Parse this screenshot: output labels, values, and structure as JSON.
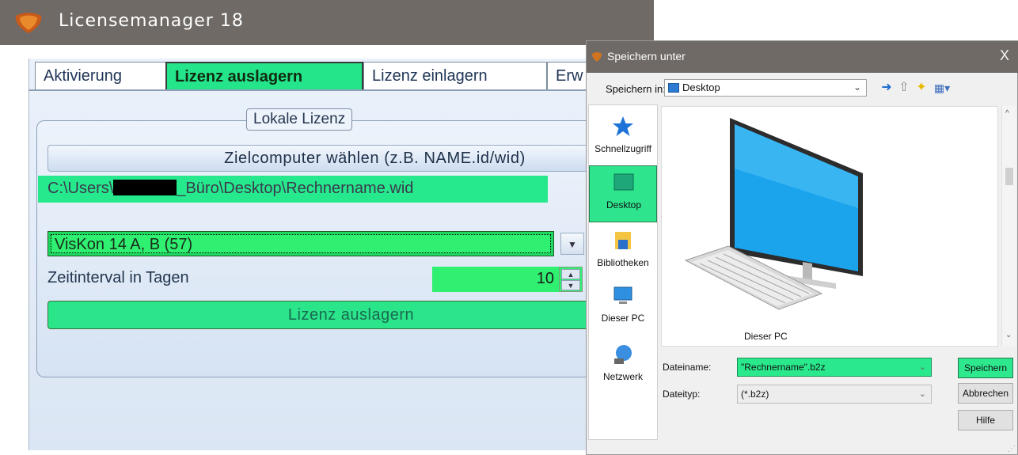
{
  "app": {
    "title": "Licensemanager 18",
    "tabs": [
      "Aktivierung",
      "Lizenz auslagern",
      "Lizenz einlagern",
      "Erw"
    ],
    "group_title": "Lokale Lizenz",
    "target_button": "Zielcomputer wählen (z.B. NAME.id/wid)",
    "path": {
      "prefix": "C:\\Users\\",
      "suffix": "_Büro\\Desktop\\Rechnername.wid"
    },
    "license_select": "VisKon 14 A, B (57)",
    "interval_label": "Zeitinterval in Tagen",
    "interval_value": "10",
    "export_button": "Lizenz auslagern"
  },
  "dialog": {
    "title": "Speichern unter",
    "close": "X",
    "save_in_label": "Speichern in:",
    "save_in_value": "Desktop",
    "places": [
      "Schnellzugriff",
      "Desktop",
      "Bibliotheken",
      "Dieser PC",
      "Netzwerk"
    ],
    "selected_place": "Desktop",
    "file_item": "Dieser PC",
    "filename_label": "Dateiname:",
    "filename_value": "\"Rechnername\".b2z",
    "filetype_label": "Dateityp:",
    "filetype_value": "(*.b2z)",
    "buttons": {
      "save": "Speichern",
      "cancel": "Abbrechen",
      "help": "Hilfe"
    }
  },
  "icons": [
    "app-logo-icon",
    "back-icon",
    "up-folder-icon",
    "new-folder-icon",
    "view-menu-icon",
    "star-icon",
    "desktop-icon",
    "library-icon",
    "computer-icon",
    "network-icon",
    "monitor-icon",
    "keyboard-icon"
  ],
  "colors": {
    "highlight": "#2ee88e",
    "titlebar": "#6f6a66",
    "tab_active": "#25e58a"
  }
}
